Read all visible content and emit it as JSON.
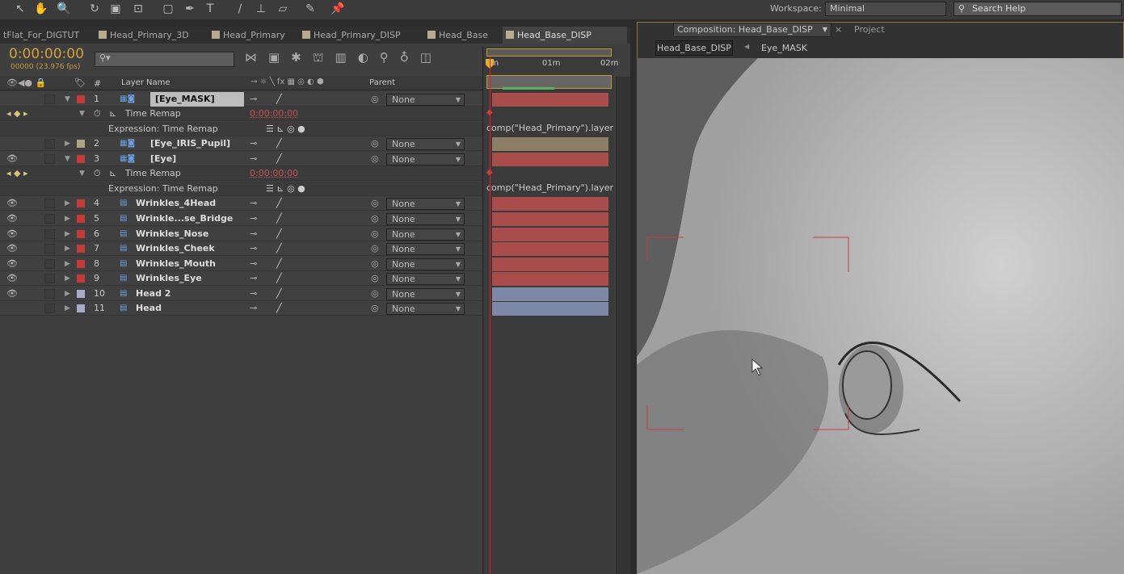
{
  "toolbar": {
    "tools": [
      "selection-tool",
      "hand-tool",
      "zoom-tool",
      "rotation-tool",
      "camera-tool",
      "pan-behind-tool",
      "rectangle-tool",
      "pen-tool",
      "type-tool",
      "brush-tool",
      "clone-stamp-tool",
      "eraser-tool",
      "roto-brush-tool",
      "puppet-pin-tool"
    ],
    "workspace_label": "Workspace:",
    "workspace_value": "Minimal",
    "search_placeholder": "Search Help"
  },
  "timeline_tabs": [
    {
      "label": "tFlat_For_DIGTUT"
    },
    {
      "label": "Head_Primary_3D"
    },
    {
      "label": "Head_Primary"
    },
    {
      "label": "Head_Primary_DISP"
    },
    {
      "label": "Head_Base"
    },
    {
      "label": "Head_Base_DISP",
      "active": true
    }
  ],
  "timeline": {
    "timecode": "0:00:00:00",
    "frames": "00000 (23.976 fps)",
    "search_placeholder": "",
    "columns": {
      "number": "#",
      "layer_name": "Layer Name",
      "parent": "Parent"
    },
    "ruler": [
      "0m",
      "01m",
      "02m"
    ],
    "rows": [
      {
        "type": "layer",
        "num": "1",
        "name": "[Eye_MASK]",
        "label_color": "#c43a3a",
        "twirl": "open",
        "kind": "precomp",
        "selected": true,
        "eye": false,
        "parent": "None",
        "bar_color": "#a94c4c"
      },
      {
        "type": "prop",
        "name": "Time Remap",
        "value": "0:00:00:00"
      },
      {
        "type": "expr",
        "name": "Expression: Time Remap",
        "code": "comp(\"Head_Primary\").layer"
      },
      {
        "type": "layer",
        "num": "2",
        "name": "[Eye_IRIS_Pupil]",
        "label_color": "#b0a283",
        "twirl": "closed",
        "kind": "precomp",
        "eye": false,
        "parent": "None",
        "bar_color": "#8c7f66"
      },
      {
        "type": "layer",
        "num": "3",
        "name": "[Eye]",
        "label_color": "#c43a3a",
        "twirl": "open",
        "kind": "precomp",
        "eye": true,
        "parent": "None",
        "bar_color": "#a94c4c"
      },
      {
        "type": "prop",
        "name": "Time Remap",
        "value": "0:00:00:00"
      },
      {
        "type": "expr",
        "name": "Expression: Time Remap",
        "code": "comp(\"Head_Primary\").layer"
      },
      {
        "type": "layer",
        "num": "4",
        "name": "Wrinkles_4Head",
        "label_color": "#c43a3a",
        "twirl": "closed",
        "kind": "psd",
        "eye": true,
        "parent": "None",
        "bar_color": "#a94c4c"
      },
      {
        "type": "layer",
        "num": "5",
        "name": "Wrinkle...se_Bridge",
        "label_color": "#c43a3a",
        "twirl": "closed",
        "kind": "psd",
        "eye": true,
        "parent": "None",
        "bar_color": "#a94c4c"
      },
      {
        "type": "layer",
        "num": "6",
        "name": "Wrinkles_Nose",
        "label_color": "#c43a3a",
        "twirl": "closed",
        "kind": "psd",
        "eye": true,
        "parent": "None",
        "bar_color": "#a94c4c"
      },
      {
        "type": "layer",
        "num": "7",
        "name": "Wrinkles_Cheek",
        "label_color": "#c43a3a",
        "twirl": "closed",
        "kind": "psd",
        "eye": true,
        "parent": "None",
        "bar_color": "#a94c4c"
      },
      {
        "type": "layer",
        "num": "8",
        "name": "Wrinkles_Mouth",
        "label_color": "#c43a3a",
        "twirl": "closed",
        "kind": "psd",
        "eye": true,
        "parent": "None",
        "bar_color": "#a94c4c"
      },
      {
        "type": "layer",
        "num": "9",
        "name": "Wrinkles_Eye",
        "label_color": "#c43a3a",
        "twirl": "closed",
        "kind": "psd",
        "eye": true,
        "parent": "None",
        "bar_color": "#a94c4c"
      },
      {
        "type": "layer",
        "num": "10",
        "name": "Head 2",
        "label_color": "#a9a9c9",
        "twirl": "closed",
        "kind": "psd",
        "eye": true,
        "parent": "None",
        "bar_color": "#7d88a6"
      },
      {
        "type": "layer",
        "num": "11",
        "name": "Head",
        "label_color": "#a9a9c9",
        "twirl": "closed",
        "kind": "psd",
        "eye": false,
        "parent": "None",
        "bar_color": "#7d88a6"
      }
    ]
  },
  "viewer": {
    "tab_label": "Composition: Head_Base_DISP",
    "project_tab": "Project",
    "breadcrumbs": [
      "Head_Base_DISP",
      "Eye_MASK"
    ]
  }
}
